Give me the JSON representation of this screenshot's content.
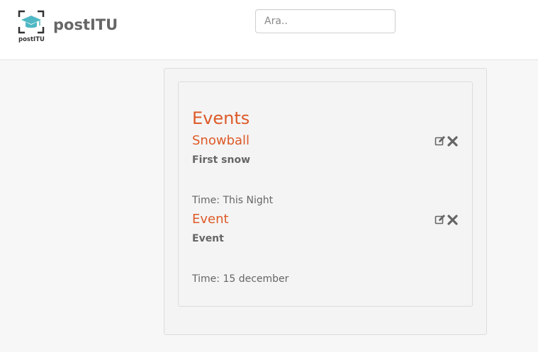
{
  "header": {
    "brand_name": "postITU",
    "logo_caption": "postITU",
    "icons": {
      "logo": "graduation-cap-icon",
      "edit": "edit-icon",
      "delete": "close-icon"
    },
    "colors": {
      "accent": "#dd5a28",
      "logo_cap": "#4fb8c4",
      "text": "#666666"
    }
  },
  "search": {
    "placeholder": "Ara..",
    "value": ""
  },
  "events_section": {
    "title": "Events",
    "time_label": "Time:",
    "items": [
      {
        "title": "Snowball",
        "description": "First snow",
        "time": "This Night"
      },
      {
        "title": "Event",
        "description": "Event",
        "time": "15 december"
      }
    ]
  }
}
